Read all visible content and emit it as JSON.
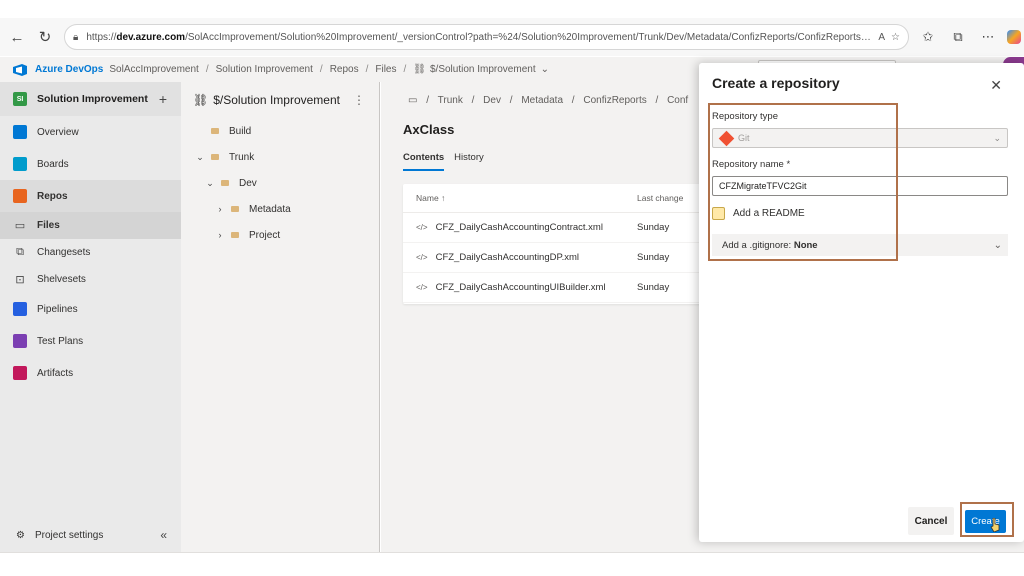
{
  "browser": {
    "url_prefix": "https://",
    "url_host": "dev.azure.com",
    "url_path": "/SolAccImprovement/Solution%20Improvement/_versionControl?path=%24/Solution%20Improvement/Trunk/Dev/Metadata/ConfizReports/ConfizReports/Ax..."
  },
  "ado_top": {
    "brand": "Azure DevOps",
    "org": "SolAccImprovement",
    "breadcrumb": [
      "Solution Improvement",
      "Repos",
      "Files"
    ],
    "repo": "$/Solution Improvement",
    "sep": "/"
  },
  "sidebar": {
    "project": "Solution Improvement",
    "project_initial": "SI",
    "items": [
      {
        "label": "Overview",
        "color": "#0078d4"
      },
      {
        "label": "Boards",
        "color": "#009ccc"
      },
      {
        "label": "Repos",
        "color": "#e8651f"
      },
      {
        "label": "Files"
      },
      {
        "label": "Changesets"
      },
      {
        "label": "Shelvesets"
      },
      {
        "label": "Pipelines",
        "color": "#2560e0"
      },
      {
        "label": "Test Plans",
        "color": "#7b3fb2"
      },
      {
        "label": "Artifacts",
        "color": "#c2185b"
      }
    ],
    "project_settings": "Project settings"
  },
  "tree": {
    "title": "$/Solution Improvement",
    "items": [
      "Build",
      "Trunk",
      "Dev",
      "Metadata",
      "Project"
    ]
  },
  "main": {
    "breadcrumb": [
      "Trunk",
      "Dev",
      "Metadata",
      "ConfizReports",
      "Conf"
    ],
    "title": "AxClass",
    "tabs": [
      "Contents",
      "History"
    ],
    "columns": {
      "name": "Name ↑",
      "last_change": "Last change"
    },
    "files": [
      {
        "name": "CFZ_DailyCashAccountingContract.xml",
        "last_change": "Sunday"
      },
      {
        "name": "CFZ_DailyCashAccountingDP.xml",
        "last_change": "Sunday"
      },
      {
        "name": "CFZ_DailyCashAccountingUIBuilder.xml",
        "last_change": "Sunday"
      }
    ]
  },
  "modal": {
    "title": "Create a repository",
    "repo_type_label": "Repository type",
    "repo_type_value": "Git",
    "repo_name_label": "Repository name *",
    "repo_name_value": "CFZMigrateTFVC2Git",
    "readme_label": "Add a README",
    "gitignore_prefix": "Add a .gitignore: ",
    "gitignore_value": "None",
    "cancel": "Cancel",
    "create": "Create"
  },
  "colors": {
    "accent": "#0078d4",
    "highlight_frame": "#b0714a"
  },
  "icons": {
    "back": "arrow-left-icon",
    "refresh": "refresh-icon",
    "lock": "lock-icon",
    "close": "close-icon",
    "git": "git-icon"
  }
}
